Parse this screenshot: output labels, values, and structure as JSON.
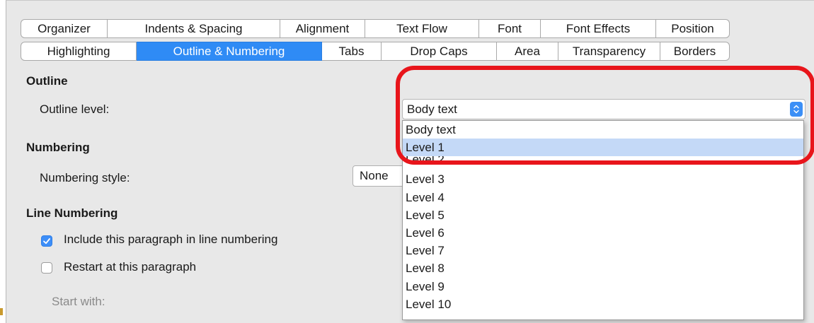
{
  "tabs": {
    "row1": [
      "Organizer",
      "Indents & Spacing",
      "Alignment",
      "Text Flow",
      "Font",
      "Font Effects",
      "Position"
    ],
    "row2": [
      "Highlighting",
      "Outline & Numbering",
      "Tabs",
      "Drop Caps",
      "Area",
      "Transparency",
      "Borders"
    ],
    "selected": "Outline & Numbering"
  },
  "outline": {
    "section_title": "Outline",
    "level_label": "Outline level:",
    "level_value": "Body text",
    "dropdown_options": [
      "Body text",
      "Level 1",
      "Level 2",
      "Level 3",
      "Level 4",
      "Level 5",
      "Level 6",
      "Level 7",
      "Level 8",
      "Level 9",
      "Level 10"
    ],
    "highlighted_option": "Level 1"
  },
  "numbering": {
    "section_title": "Numbering",
    "style_label": "Numbering style:",
    "style_value": "None"
  },
  "line_numbering": {
    "section_title": "Line Numbering",
    "include_label": "Include this paragraph in line numbering",
    "include_checked": true,
    "restart_label": "Restart at this paragraph",
    "restart_checked": false,
    "start_with_label": "Start with:"
  },
  "colors": {
    "selected_tab": "#2f8bf5",
    "highlight_ring": "#e8151b",
    "dropdown_highlight": "#c4d9f7",
    "checkbox_checked": "#3d8ef8"
  },
  "icons": [
    "checkmark-icon",
    "up-down-chevron-icon"
  ]
}
